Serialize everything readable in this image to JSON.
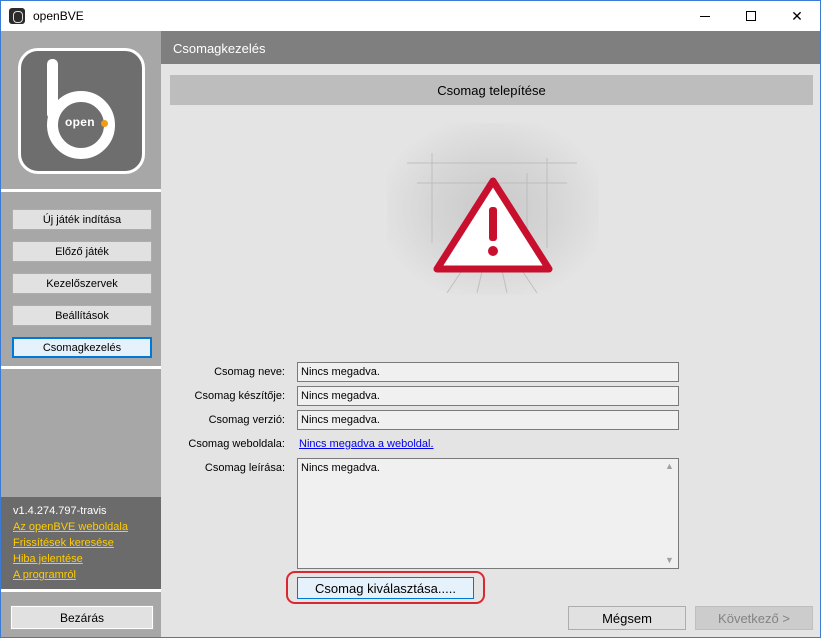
{
  "window": {
    "title": "openBVE",
    "controls": {
      "minimize": "minimize-icon",
      "maximize": "maximize-icon",
      "close": "close-icon"
    }
  },
  "sidebar": {
    "logo_text": "open",
    "nav": [
      {
        "label": "Új játék indítása",
        "active": false
      },
      {
        "label": "Előző játék",
        "active": false
      },
      {
        "label": "Kezelőszervek",
        "active": false
      },
      {
        "label": "Beállítások",
        "active": false
      },
      {
        "label": "Csomagkezelés",
        "active": true
      }
    ],
    "version": "v1.4.274.797-travis",
    "links": [
      "Az openBVE weboldala",
      "Frissítések keresése",
      "Hiba jelentése",
      "A programról"
    ],
    "close_label": "Bezárás"
  },
  "main": {
    "header": "Csomagkezelés",
    "section_title": "Csomag telepítése",
    "image_icon": "warning-triangle-icon",
    "fields": {
      "name_label": "Csomag neve:",
      "name_value": "Nincs megadva.",
      "author_label": "Csomag készítője:",
      "author_value": "Nincs megadva.",
      "version_label": "Csomag verzió:",
      "version_value": "Nincs megadva.",
      "website_label": "Csomag weboldala:",
      "website_value": "Nincs megadva a weboldal.",
      "description_label": "Csomag leírása:",
      "description_value": "Nincs megadva."
    },
    "select_button": "Csomag kiválasztása.....",
    "cancel_button": "Mégsem",
    "next_button": "Következő >"
  },
  "colors": {
    "accent": "#0078d7",
    "link_yellow": "#ffcc00",
    "highlight_ring": "#d9282f",
    "warning_red": "#c8102e"
  }
}
